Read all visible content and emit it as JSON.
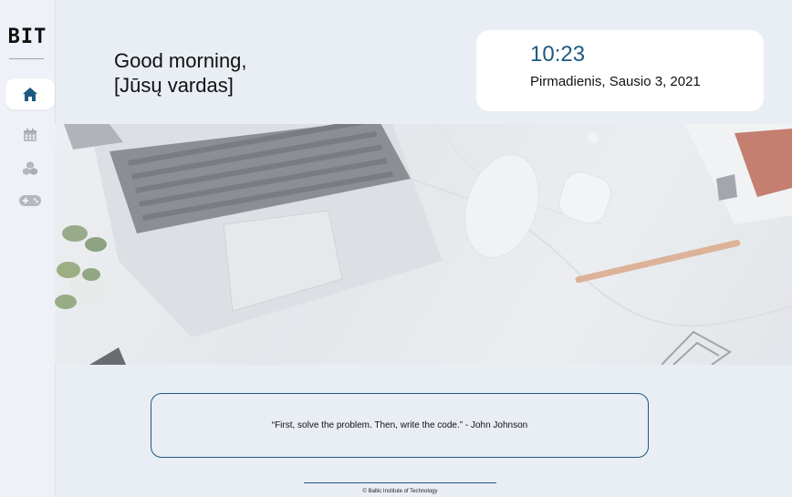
{
  "brand": {
    "logo_text": "BIT"
  },
  "sidebar": {
    "items": [
      {
        "icon": "home-icon",
        "active": true
      },
      {
        "icon": "calendar-icon",
        "active": false
      },
      {
        "icon": "cubes-icon",
        "active": false
      },
      {
        "icon": "gamepad-icon",
        "active": false
      }
    ]
  },
  "header": {
    "greeting_line1": "Good morning,",
    "greeting_line2": "[Jūsų vardas]"
  },
  "clock": {
    "time": "10:23",
    "date": "Pirmadienis, Sausio 3, 2021"
  },
  "quote": {
    "text": "“First, solve the problem. Then, write the code.” - John Johnson"
  },
  "footer": {
    "copyright": "© Baltic Institute of Technology"
  },
  "colors": {
    "accent": "#1e5a80",
    "background": "#e9edf4",
    "card": "#ffffff"
  }
}
